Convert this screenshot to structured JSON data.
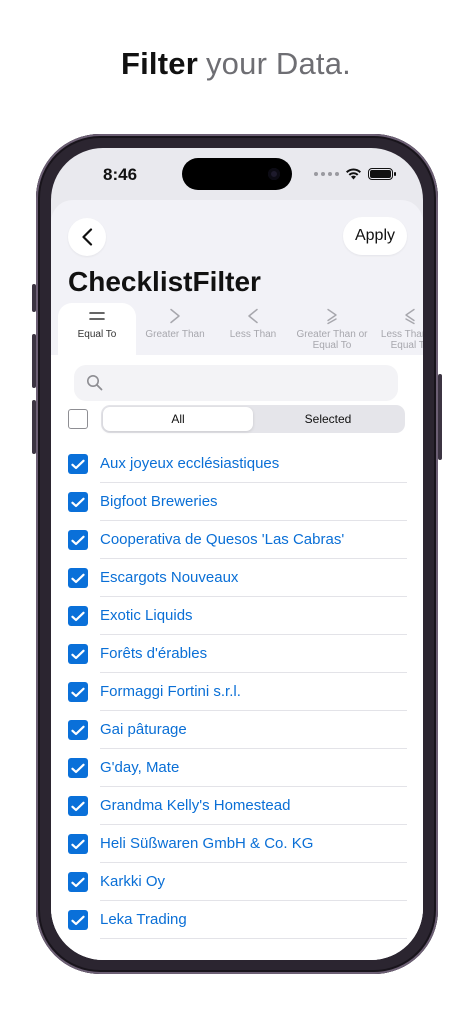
{
  "headline": {
    "bold": "Filter",
    "rest": "your Data."
  },
  "status": {
    "time": "8:46"
  },
  "nav": {
    "apply_label": "Apply",
    "title": "ChecklistFilter"
  },
  "operators": [
    {
      "label": "Equal To",
      "icon": "equal-icon",
      "active": true
    },
    {
      "label": "Greater Than",
      "icon": "greater-than-icon",
      "active": false
    },
    {
      "label": "Less Than",
      "icon": "less-than-icon",
      "active": false
    },
    {
      "label": "Greater Than or Equal To",
      "icon": "greater-equal-icon",
      "active": false
    },
    {
      "label": "Less Than or Equal To",
      "icon": "less-equal-icon",
      "active": false
    }
  ],
  "search": {
    "placeholder": "",
    "value": ""
  },
  "segments": {
    "all": "All",
    "selected": "Selected",
    "active": "All"
  },
  "items": [
    {
      "label": "Aux joyeux ecclésiastiques",
      "checked": true
    },
    {
      "label": "Bigfoot Breweries",
      "checked": true
    },
    {
      "label": "Cooperativa de Quesos 'Las Cabras'",
      "checked": true
    },
    {
      "label": "Escargots Nouveaux",
      "checked": true
    },
    {
      "label": "Exotic Liquids",
      "checked": true
    },
    {
      "label": "Forêts d'érables",
      "checked": true
    },
    {
      "label": "Formaggi Fortini s.r.l.",
      "checked": true
    },
    {
      "label": "Gai pâturage",
      "checked": true
    },
    {
      "label": "G'day, Mate",
      "checked": true
    },
    {
      "label": "Grandma Kelly's Homestead",
      "checked": true
    },
    {
      "label": "Heli Süßwaren GmbH & Co. KG",
      "checked": true
    },
    {
      "label": "Karkki Oy",
      "checked": true
    },
    {
      "label": "Leka Trading",
      "checked": true
    }
  ],
  "colors": {
    "accent": "#0a70d9",
    "link": "#0a6fd6",
    "phone_frame": "#2b2530"
  }
}
